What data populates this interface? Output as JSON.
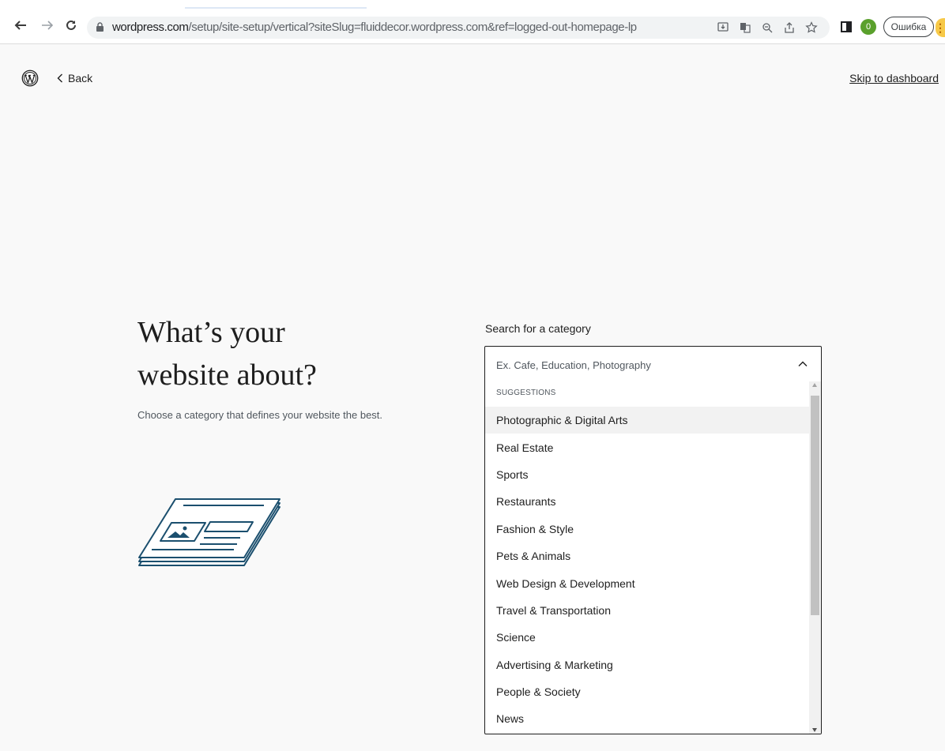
{
  "browser": {
    "url_host": "wordpress.com",
    "url_path": "/setup/site-setup/vertical?siteSlug=fluiddecor.wordpress.com&ref=logged-out-homepage-lp",
    "profile_initial": "0",
    "error_label": "Ошибка",
    "icons": [
      "back-arrow-icon",
      "forward-arrow-icon",
      "reload-icon",
      "lock-icon",
      "install-app-icon",
      "translate-icon",
      "zoom-icon",
      "share-icon",
      "bookmark-star-icon",
      "side-panel-icon",
      "menu-dots-icon"
    ]
  },
  "header": {
    "back_label": "Back",
    "skip_label": "Skip to dashboard"
  },
  "main": {
    "headline": "What’s your website about?",
    "subtitle": "Choose a category that defines your website the best."
  },
  "category_search": {
    "label": "Search for a category",
    "placeholder": "Ex. Cafe, Education, Photography",
    "value": "",
    "suggestions_heading": "SUGGESTIONS",
    "highlighted_index": 0,
    "options": [
      "Photographic & Digital Arts",
      "Real Estate",
      "Sports",
      "Restaurants",
      "Fashion & Style",
      "Pets & Animals",
      "Web Design & Development",
      "Travel & Transportation",
      "Science",
      "Advertising & Marketing",
      "People & Society",
      "News"
    ]
  },
  "colors": {
    "text": "#1e1e1e",
    "muted": "#50575e",
    "illustration_stroke": "#1b4f6e",
    "option_highlight": "#f2f2f2",
    "profile_green": "#5aa02c"
  }
}
